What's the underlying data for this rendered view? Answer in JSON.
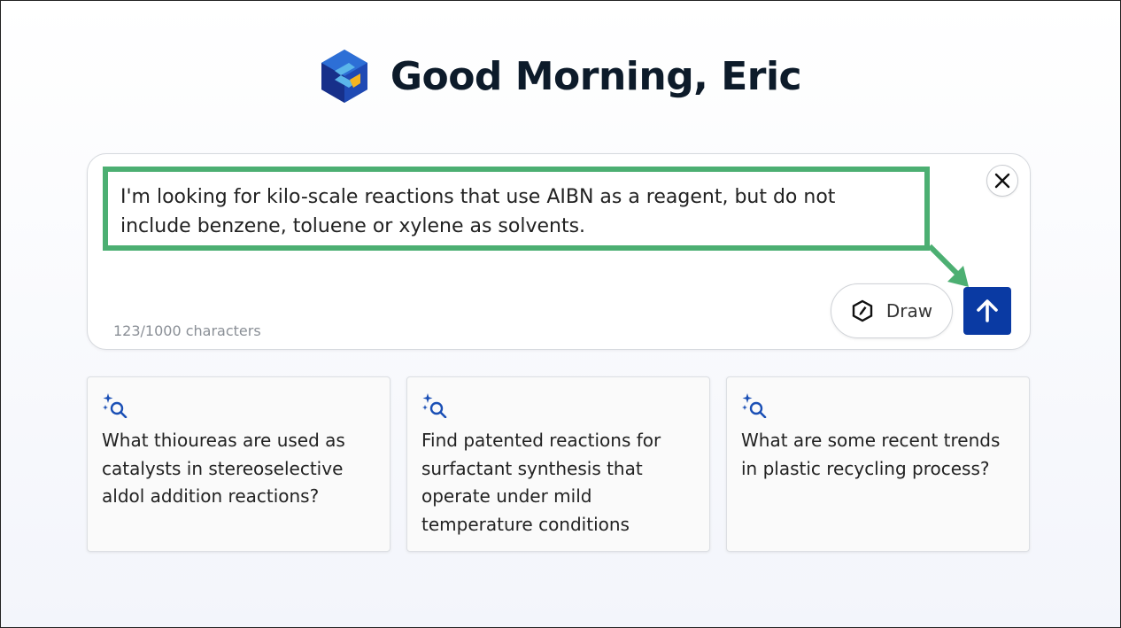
{
  "greeting": {
    "text": "Good Morning, Eric"
  },
  "prompt": {
    "text": "I'm looking for kilo-scale reactions that use AIBN as a reagent, but do not include benzene, toluene or xylene as solvents.",
    "char_count": "123/1000 characters"
  },
  "actions": {
    "draw_label": "Draw",
    "close_icon": "close-icon",
    "send_icon": "arrow-up-icon"
  },
  "suggestions": [
    {
      "text": "What thioureas are used as catalysts in stereoselective aldol addition reactions?"
    },
    {
      "text": "Find patented reactions for surfactant synthesis that operate under mild temperature conditions"
    },
    {
      "text": "What are some recent trends in plastic recycling process?"
    }
  ],
  "colors": {
    "accent": "#0a3aa3",
    "highlight": "#4caf72",
    "icon_blue": "#1a4fb5"
  }
}
